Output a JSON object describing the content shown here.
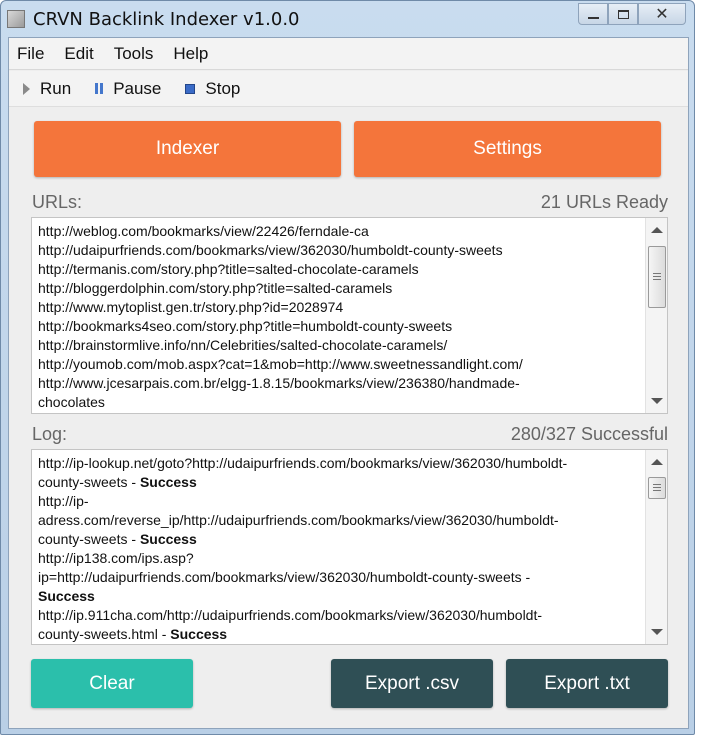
{
  "window": {
    "title": "CRVN Backlink Indexer v1.0.0",
    "controls": {
      "minimize_icon": "minimize-icon",
      "maximize_icon": "maximize-icon",
      "close_icon": "close-icon"
    }
  },
  "menu": {
    "items": [
      "File",
      "Edit",
      "Tools",
      "Help"
    ]
  },
  "toolbar": {
    "run_label": "Run",
    "pause_label": "Pause",
    "stop_label": "Stop"
  },
  "tabs": {
    "indexer_label": "Indexer",
    "settings_label": "Settings"
  },
  "urls": {
    "label": "URLs:",
    "status": "21 URLs Ready",
    "lines": [
      "http://weblog.com/bookmarks/view/22426/ferndale-ca",
      "http://udaipurfriends.com/bookmarks/view/362030/humboldt-county-sweets",
      "http://termanis.com/story.php?title=salted-chocolate-caramels",
      "http://bloggerdolphin.com/story.php?title=salted-caramels",
      "http://www.mytoplist.gen.tr/story.php?id=2028974",
      "http://bookmarks4seo.com/story.php?title=humboldt-county-sweets",
      "http://brainstormlive.info/nn/Celebrities/salted-chocolate-caramels/",
      "http://youmob.com/mob.aspx?cat=1&mob=http://www.sweetnessandlight.com/",
      "http://www.jcesarpais.com.br/elgg-1.8.15/bookmarks/view/236380/handmade-",
      "chocolates"
    ]
  },
  "log": {
    "label": "Log:",
    "status": "280/327 Successful",
    "entries": [
      {
        "url_lines": [
          "http://ip-lookup.net/goto?http://udaipurfriends.com/bookmarks/view/362030/humboldt-",
          "county-sweets - "
        ],
        "result": "Success"
      },
      {
        "url_lines": [
          "http://ip-",
          "adress.com/reverse_ip/http://udaipurfriends.com/bookmarks/view/362030/humboldt-",
          "county-sweets - "
        ],
        "result": "Success"
      },
      {
        "url_lines": [
          "http://ip138.com/ips.asp?",
          "ip=http://udaipurfriends.com/bookmarks/view/362030/humboldt-county-sweets - "
        ],
        "result": "Success"
      },
      {
        "url_lines": [
          "http://ip.911cha.com/http://udaipurfriends.com/bookmarks/view/362030/humboldt-",
          "county-sweets.html - "
        ],
        "result": "Success"
      }
    ]
  },
  "actions": {
    "clear_label": "Clear",
    "export_csv_label": "Export .csv",
    "export_txt_label": "Export .txt"
  },
  "colors": {
    "accent_orange": "#f4753b",
    "clear_teal": "#2bbfab",
    "export_dark": "#2f4f55"
  }
}
